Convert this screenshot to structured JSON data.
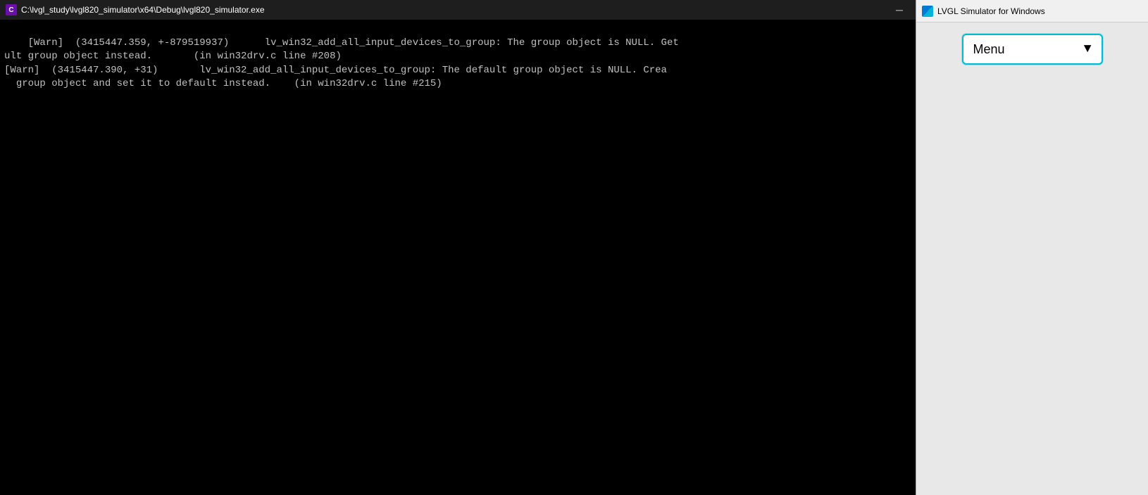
{
  "console": {
    "title": "C:\\lvgl_study\\lvgl820_simulator\\x64\\Debug\\lvgl820_simulator.exe",
    "icon_label": "C",
    "lines": [
      "[Warn]  (3415447.359, +-879519937)      lv_win32_add_all_input_devices_to_group: The group object is NULL. Get",
      "ult group object instead.       (in win32drv.c line #208)",
      "[Warn]  (3415447.390, +31)       lv_win32_add_all_input_devices_to_group: The default group object is NULL. Crea",
      "  group object and set it to default instead.    (in win32drv.c line #215)"
    ],
    "minimize_btn": "─",
    "close_btn": "✕"
  },
  "simulator": {
    "title": "LVGL Simulator for Windows",
    "menu_label": "Menu",
    "dropdown_arrow": "▼"
  }
}
